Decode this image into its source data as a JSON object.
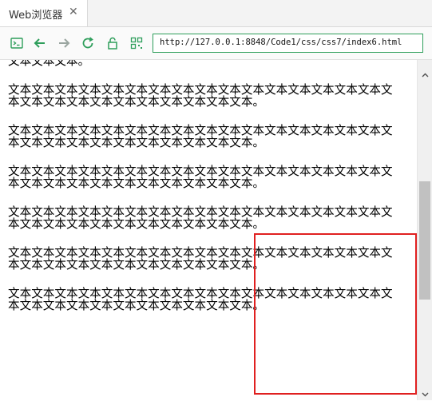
{
  "tab": {
    "title": "Web浏览器",
    "close": "✕"
  },
  "toolbar": {
    "icons": [
      "terminal-icon",
      "back-arrow-icon",
      "forward-arrow-icon",
      "reload-icon",
      "lock-icon",
      "qr-grid-icon"
    ],
    "url": "http://127.0.0.1:8848/Code1/css/css7/index6.html"
  },
  "content": {
    "paragraphs": [
      "文本文本文本。",
      "文本文本文本文本文本文本文本文本文本文本文本文本文本文本文本文本文本文本文本文本文本文本文本文本文本文本文本。",
      "文本文本文本文本文本文本文本文本文本文本文本文本文本文本文本文本文本文本文本文本文本文本文本文本文本文本文本。",
      "文本文本文本文本文本文本文本文本文本文本文本文本文本文本文本文本文本文本文本文本文本文本文本文本文本文本文本。",
      "文本文本文本文本文本文本文本文本文本文本文本文本文本文本文本文本文本文本文本文本文本文本文本文本文本文本文本。",
      "文本文本文本文本文本文本文本文本文本文本文本文本文本文本文本文本文本文本文本文本文本文本文本文本文本文本文本。",
      "文本文本文本文本文本文本文本文本文本文本文本文本文本文本文本文本文本文本文本文本文本文本文本文本文本文本文本。"
    ]
  },
  "colors": {
    "accent": "#2e9e5b",
    "annotation": "#e02020"
  }
}
